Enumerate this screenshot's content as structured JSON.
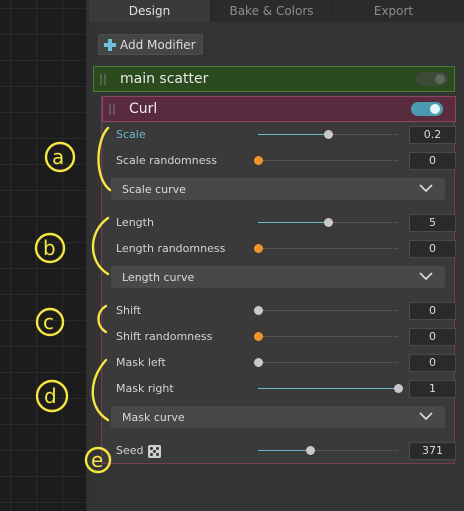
{
  "tabs": [
    {
      "label": "Design",
      "active": true
    },
    {
      "label": "Bake & Colors",
      "active": false
    },
    {
      "label": "Export",
      "active": false
    }
  ],
  "toolbar": {
    "add_modifier_label": "Add Modifier",
    "add_icon": "plus-icon"
  },
  "modifiers": {
    "scatter": {
      "title": "main scatter",
      "enabled": false,
      "color": "#2b4a1e"
    },
    "curl": {
      "title": "Curl",
      "enabled": true,
      "color": "#5a2a3e"
    }
  },
  "params": {
    "scale": {
      "label": "Scale",
      "value": "0.2",
      "fraction": 0.5
    },
    "scale_randomness": {
      "label": "Scale randomness",
      "value": "0",
      "fraction": 0.0
    },
    "scale_curve": {
      "label": "Scale curve"
    },
    "length": {
      "label": "Length",
      "value": "5",
      "fraction": 0.5
    },
    "length_randomness": {
      "label": "Length randomness",
      "value": "0",
      "fraction": 0.0
    },
    "length_curve": {
      "label": "Length curve"
    },
    "shift": {
      "label": "Shift",
      "value": "0",
      "fraction": 0.0
    },
    "shift_randomness": {
      "label": "Shift randomness",
      "value": "0",
      "fraction": 0.0
    },
    "mask_left": {
      "label": "Mask left",
      "value": "0",
      "fraction": 0.0
    },
    "mask_right": {
      "label": "Mask right",
      "value": "1",
      "fraction": 1.0
    },
    "mask_curve": {
      "label": "Mask curve"
    },
    "seed": {
      "label": "Seed",
      "value": "371",
      "fraction": 0.37,
      "icon": "dice-icon"
    }
  },
  "annotations": [
    "a",
    "b",
    "c",
    "d",
    "e"
  ],
  "colors": {
    "accent": "#6ab6cf",
    "random": "#f0962a",
    "annotation": "#f5e642"
  }
}
